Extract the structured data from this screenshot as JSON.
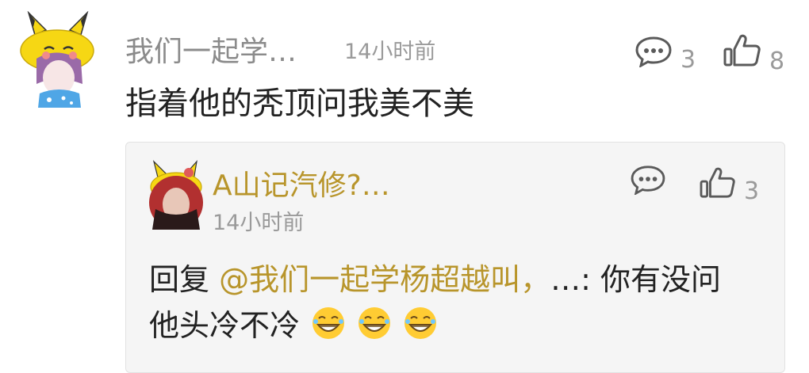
{
  "comment": {
    "username": "我们一起学…",
    "time": "14小时前",
    "reply_count": "3",
    "like_count": "8",
    "text": "指着他的秃顶问我美不美"
  },
  "reply": {
    "username": "A山记汽修?…",
    "time": "14小时前",
    "reply_count": "",
    "like_count": "3",
    "prefix": "回复 ",
    "mention": "@我们一起学杨超越叫，",
    "suffix": "…: 你有没问",
    "line2": "他头冷不冷",
    "emoji_icon": "grinning-face-icon"
  },
  "colors": {
    "username": "#8b8b8b",
    "mention": "#b8952b",
    "meta": "#9a9a9a",
    "reply_bg": "#f5f5f5"
  }
}
